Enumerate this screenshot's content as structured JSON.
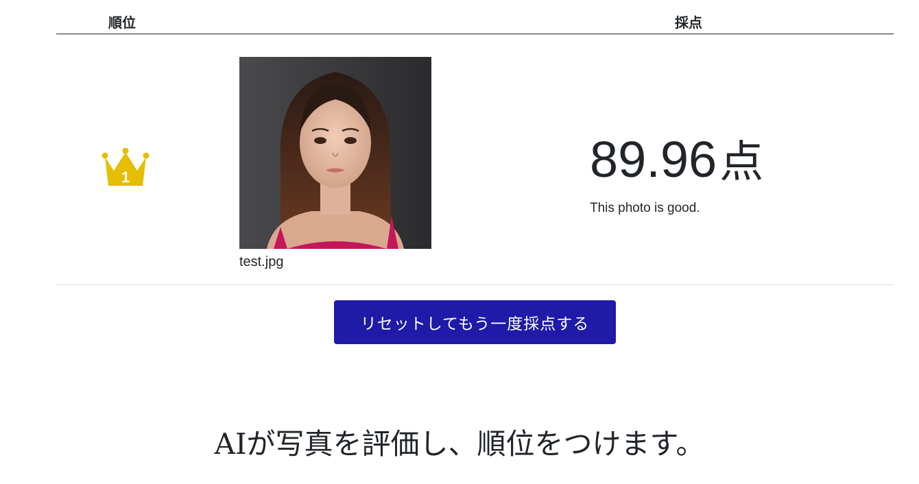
{
  "table": {
    "headers": {
      "rank": "順位",
      "score": "採点"
    },
    "rows": [
      {
        "rank": "1",
        "rank_icon": "crown-icon",
        "image_alt": "portrait photo of a woman",
        "filename": "test.jpg",
        "score": "89.96",
        "score_unit": "点",
        "comment": "This photo is good."
      }
    ]
  },
  "reset_button": {
    "label": "リセットしてもう一度採点する"
  },
  "tagline": "AIが写真を評価し、順位をつけます。",
  "colors": {
    "crown": "#e6bd00",
    "button_bg": "#1f1aa8",
    "text": "#212529"
  }
}
